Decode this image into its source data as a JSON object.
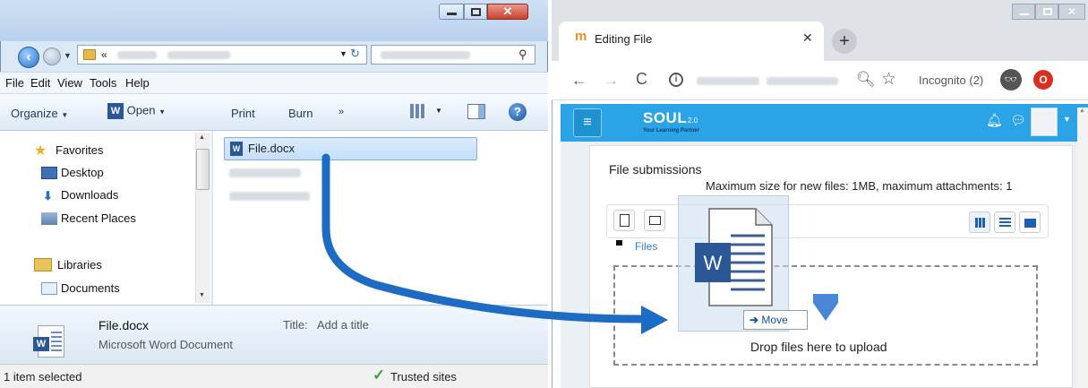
{
  "explorer": {
    "menu": [
      "File",
      "Edit",
      "View",
      "Tools",
      "Help"
    ],
    "toolbar": {
      "organize": "Organize",
      "open": "Open",
      "print": "Print",
      "burn": "Burn",
      "more": "»"
    },
    "nav": {
      "favorites": "Favorites",
      "desktop": "Desktop",
      "downloads": "Downloads",
      "recent": "Recent Places",
      "libraries": "Libraries",
      "documents": "Documents"
    },
    "files": {
      "selected": "File.docx"
    },
    "details": {
      "filename": "File.docx",
      "type": "Microsoft Word Document",
      "title_label": "Title:",
      "title_value": "Add a title"
    },
    "status": {
      "selection": "1 item selected",
      "zone": "Trusted sites"
    },
    "colors": {
      "accent": "#2a6fc7",
      "selection": "#c4dff8"
    }
  },
  "chrome": {
    "tab_title": "Editing File",
    "tab_favicon": "m",
    "incognito": "Incognito (2)",
    "colors": {
      "brand": "#2aa4e6",
      "tab_strip": "#dfe3e8"
    }
  },
  "moodle": {
    "logo": "SOUL",
    "logo_version": "2.0",
    "logo_tagline": "Your Learning Partner",
    "section_title": "File submissions",
    "limits": "Maximum size for new files: 1MB, maximum attachments: 1",
    "breadcrumb": "Files",
    "drop_text": "Drop files here to upload"
  },
  "drag": {
    "badge": "Move",
    "badge_icon": "right-arrow-icon",
    "doc_icon": "W",
    "path_color": "#1e6bc4"
  }
}
